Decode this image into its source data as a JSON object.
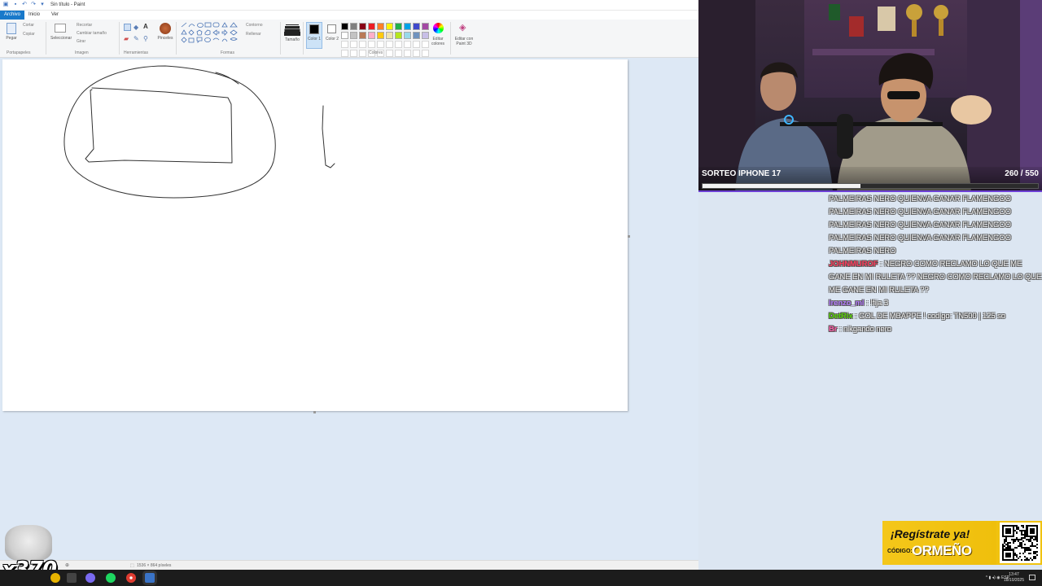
{
  "paint": {
    "title": "Sin título - Paint",
    "menu": [
      "Archivo",
      "Inicio",
      "Ver"
    ],
    "ribbon": {
      "clipboard": {
        "paste": "Pegar",
        "cut": "Cortar",
        "copy": "Copiar",
        "group": "Portapapeles"
      },
      "image": {
        "select": "Seleccionar",
        "crop": "Recortar",
        "resize": "Cambiar tamaño",
        "rotate": "Girar",
        "group": "Imagen"
      },
      "tools": {
        "group": "Herramientas",
        "brushes": "Pinceles"
      },
      "shapes": {
        "outline": "Contorno",
        "fill": "Rellenar",
        "group": "Formas"
      },
      "size": "Tamaño",
      "color1": "Color 1",
      "color2": "Color 2",
      "colors_group": "Colores",
      "edit_colors": "Editar colores",
      "paint3d": "Editar con Paint 3D",
      "palette": [
        "#000000",
        "#7f7f7f",
        "#880015",
        "#ed1c24",
        "#ff7f27",
        "#fff200",
        "#22b14c",
        "#00a2e8",
        "#3f48cc",
        "#a349a4",
        "#ffffff",
        "#c3c3c3",
        "#b97a57",
        "#ffaec9",
        "#ffc90e",
        "#efe4b0",
        "#b5e61d",
        "#99d9ea",
        "#7092be",
        "#c8bfe7"
      ]
    },
    "status": {
      "dimensions": "1536 × 864 píxeles"
    }
  },
  "stream": {
    "giveaway": {
      "label": "SORTEO IPHONE 17",
      "count": "260 / 550",
      "progress": 0.47
    },
    "chat": [
      {
        "user": "",
        "user_color": "#ffffff",
        "text": "PALMEIRAS NERO QUIENVA GANAR FLAMENGOO"
      },
      {
        "user": "",
        "user_color": "#ffffff",
        "text": "PALMEIRAS NERO QUIENVA GANAR FLAMENGOO"
      },
      {
        "user": "",
        "user_color": "#ffffff",
        "text": "PALMEIRAS NERO QUIENVA GANAR FLAMENGOO"
      },
      {
        "user": "",
        "user_color": "#ffffff",
        "text": "PALMEIRAS NERO QUIENVA GANAR FLAMENGOO"
      },
      {
        "user": "",
        "user_color": "#ffffff",
        "text": "PALMEIRAS NERO"
      },
      {
        "user": "JOHNMUROF",
        "user_color": "#ff3b5c",
        "text": ": NEGRO COMO RECLAMO LO QUE ME GANE EN MI RULETA ?? NEGRO COMO RECLAMO LO QUE ME GANE EN MI RULETA ??"
      },
      {
        "user": "lrenzo_ml",
        "user_color": "#b57cff",
        "text": ": !fija 3"
      },
      {
        "user": "DetRix",
        "user_color": "#55d400",
        "text": ": GOL DE MBAPPE ! codigo: TN500 | 125 so"
      },
      {
        "user": "Br",
        "user_color": "#ff5ca8",
        "text": ": nikgando nero"
      }
    ],
    "cat_counter": "x370",
    "promo": {
      "title": "¡Regístrate ya!",
      "code_label": "CÓDIGO:",
      "code": "ORMEÑO"
    }
  },
  "taskbar": {
    "lang": "ESP",
    "time": "13:47",
    "date": "18/10/2025"
  }
}
